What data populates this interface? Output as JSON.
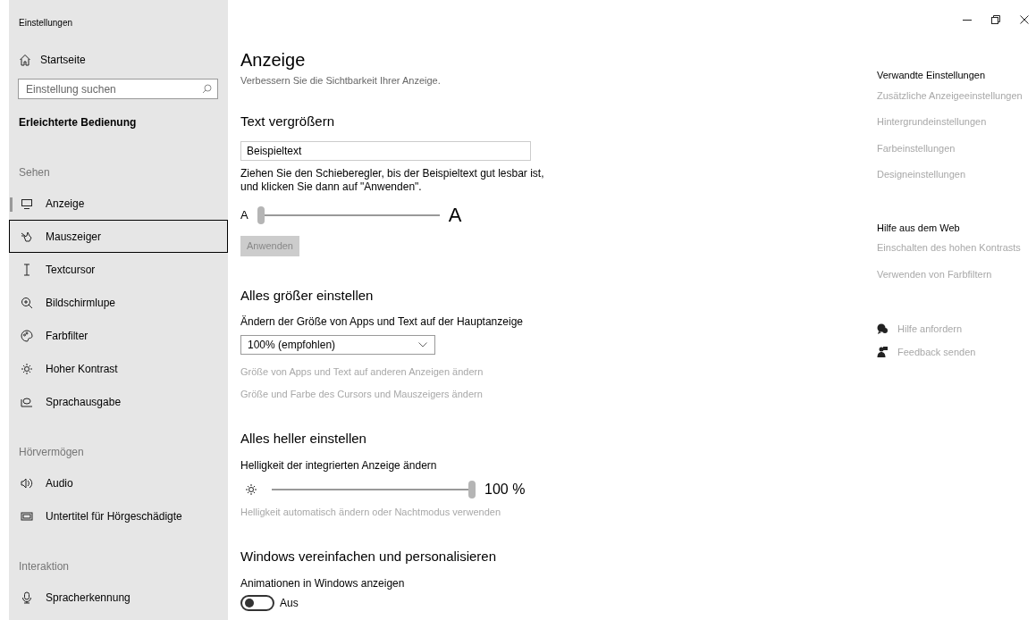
{
  "window": {
    "title": "Einstellungen"
  },
  "sidebar": {
    "home": "Startseite",
    "search": {
      "placeholder": "Einstellung suchen"
    },
    "category": "Erleichterte Bedienung",
    "groups": [
      {
        "heading": "Sehen",
        "items": [
          {
            "label": "Anzeige",
            "selected": true,
            "focused": false
          },
          {
            "label": "Mauszeiger",
            "selected": false,
            "focused": true
          },
          {
            "label": "Textcursor",
            "selected": false,
            "focused": false
          },
          {
            "label": "Bildschirmlupe",
            "selected": false,
            "focused": false
          },
          {
            "label": "Farbfilter",
            "selected": false,
            "focused": false
          },
          {
            "label": "Hoher Kontrast",
            "selected": false,
            "focused": false
          },
          {
            "label": "Sprachausgabe",
            "selected": false,
            "focused": false
          }
        ]
      },
      {
        "heading": "Hörvermögen",
        "items": [
          {
            "label": "Audio",
            "selected": false,
            "focused": false
          },
          {
            "label": "Untertitel für Hörgeschädigte",
            "selected": false,
            "focused": false
          }
        ]
      },
      {
        "heading": "Interaktion",
        "items": [
          {
            "label": "Spracherkennung",
            "selected": false,
            "focused": false
          }
        ]
      }
    ]
  },
  "main": {
    "title": "Anzeige",
    "subtitle": "Verbessern Sie die Sichtbarkeit Ihrer Anzeige.",
    "sections": [
      {
        "heading": "Text vergrößern",
        "controls": [
          {
            "kind": "textbox",
            "value": "Beispieltext"
          },
          {
            "kind": "label",
            "text": "Ziehen Sie den Schieberegler, bis der Beispieltext gut lesbar ist, und klicken Sie dann auf \"Anwenden\"."
          },
          {
            "kind": "size_slider",
            "small_label": "A",
            "large_label": "A",
            "level": 0
          },
          {
            "kind": "button",
            "text": "Anwenden",
            "disabled": true
          }
        ]
      },
      {
        "heading": "Alles größer einstellen",
        "controls": [
          {
            "kind": "label",
            "text": "Ändern der Größe von Apps und Text auf der Hauptanzeige"
          },
          {
            "kind": "dropdown",
            "value": "100% (empfohlen)"
          },
          {
            "kind": "link",
            "text": "Größe von Apps und Text auf anderen Anzeigen ändern"
          },
          {
            "kind": "link",
            "text": "Größe und Farbe des Cursors und Mauszeigers ändern"
          }
        ]
      },
      {
        "heading": "Alles heller einstellen",
        "controls": [
          {
            "kind": "label",
            "text": "Helligkeit der integrierten Anzeige ändern"
          },
          {
            "kind": "brightness_slider",
            "level": 1,
            "reading": "100 %"
          },
          {
            "kind": "link",
            "text": "Helligkeit automatisch ändern oder Nachtmodus verwenden"
          }
        ]
      },
      {
        "heading": "Windows vereinfachen und personalisieren",
        "controls": [
          {
            "kind": "label",
            "text": "Animationen in Windows anzeigen"
          },
          {
            "kind": "toggle",
            "on": false,
            "text": "Aus"
          }
        ]
      }
    ]
  },
  "aside": {
    "groups": [
      {
        "heading": "Verwandte Einstellungen",
        "links": [
          "Zusätzliche Anzeigeeinstellungen",
          "Hintergrundeinstellungen",
          "Farbeinstellungen",
          "Designeinstellungen"
        ]
      },
      {
        "heading": "Hilfe aus dem Web",
        "links": [
          "Einschalten des hohen Kontrasts",
          "Verwenden von Farbfiltern"
        ]
      }
    ],
    "actions": [
      "Hilfe anfordern",
      "Feedback senden"
    ]
  }
}
